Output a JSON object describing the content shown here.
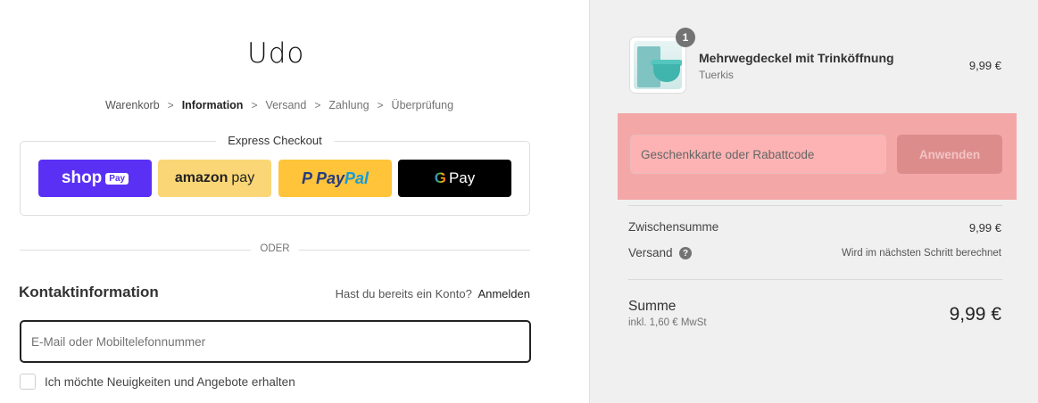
{
  "store": {
    "logo_text": "Udo"
  },
  "breadcrumb": {
    "items": [
      {
        "label": "Warenkorb"
      },
      {
        "label": "Information"
      },
      {
        "label": "Versand"
      },
      {
        "label": "Zahlung"
      },
      {
        "label": "Überprüfung"
      }
    ],
    "separator": ">"
  },
  "express_checkout": {
    "title": "Express Checkout",
    "shop_pay": {
      "text": "shop",
      "pill": "Pay"
    },
    "amazon_pay": {
      "text_bold": "amazon",
      "text_light": "pay"
    },
    "paypal": {
      "logo": "P",
      "text_1": "Pay",
      "text_2": "Pal"
    },
    "google_pay": {
      "g": "G",
      "text": "Pay"
    }
  },
  "divider": {
    "text": "ODER"
  },
  "contact": {
    "title": "Kontaktinformation",
    "login_prompt": "Hast du bereits ein Konto?",
    "login_link": "Anmelden",
    "email_placeholder": "E-Mail oder Mobiltelefonnummer",
    "newsletter_label": "Ich möchte Neuigkeiten und Angebote erhalten"
  },
  "order": {
    "product": {
      "name": "Mehrwegdeckel mit Trinköffnung",
      "variant": "Tuerkis",
      "quantity": "1",
      "price": "9,99 €"
    },
    "discount": {
      "placeholder": "Geschenkkarte oder Rabattcode",
      "apply_label": "Anwenden"
    },
    "subtotal": {
      "label": "Zwischensumme",
      "value": "9,99 €"
    },
    "shipping": {
      "label": "Versand",
      "help": "?",
      "value": "Wird im nächsten Schritt berechnet"
    },
    "total": {
      "label": "Summe",
      "tax_note": "inkl. 1,60 € MwSt",
      "value": "9,99 €"
    }
  },
  "colors": {
    "shop_pay": "#5a31f4",
    "amazon_pay": "#fad676",
    "paypal": "#ffc439",
    "google_pay": "#000000",
    "discount_highlight": "#f4a7a7"
  }
}
